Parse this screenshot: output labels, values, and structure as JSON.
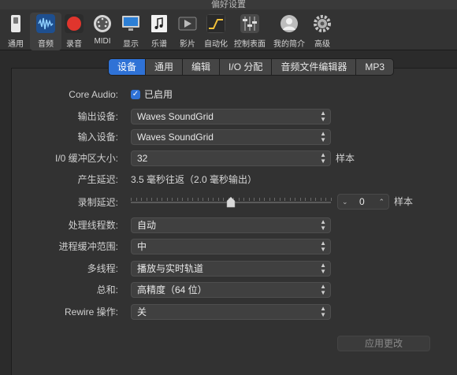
{
  "window": {
    "title": "偏好设置"
  },
  "toolbar": [
    {
      "label": "通用",
      "icon": "switch-icon"
    },
    {
      "label": "音频",
      "icon": "waveform-icon"
    },
    {
      "label": "录音",
      "icon": "record-icon"
    },
    {
      "label": "MIDI",
      "icon": "midi-port-icon"
    },
    {
      "label": "显示",
      "icon": "monitor-icon"
    },
    {
      "label": "乐谱",
      "icon": "score-icon"
    },
    {
      "label": "影片",
      "icon": "movie-icon"
    },
    {
      "label": "自动化",
      "icon": "automation-icon"
    },
    {
      "label": "控制表面",
      "icon": "faders-icon"
    },
    {
      "label": "我的简介",
      "icon": "profile-icon"
    },
    {
      "label": "高级",
      "icon": "gear-icon"
    }
  ],
  "tabs": [
    "设备",
    "通用",
    "编辑",
    "I/O 分配",
    "音频文件编辑器",
    "MP3"
  ],
  "selected_tab": "设备",
  "settings": {
    "core_audio": {
      "label": "Core Audio:",
      "checkbox": "已启用",
      "checked": true
    },
    "output_device": {
      "label": "输出设备:",
      "value": "Waves SoundGrid"
    },
    "input_device": {
      "label": "输入设备:",
      "value": "Waves SoundGrid"
    },
    "buffer_size": {
      "label": "I/0 缓冲区大小:",
      "value": "32",
      "unit": "样本"
    },
    "latency": {
      "label": "产生延迟:",
      "value": "3.5 毫秒往返（2.0 毫秒输出）"
    },
    "record_delay": {
      "label": "录制延迟:",
      "value": "0",
      "unit": "样本",
      "slider_position": 0.5
    },
    "process_threads": {
      "label": "处理线程数:",
      "value": "自动"
    },
    "process_buffer": {
      "label": "进程缓冲范围:",
      "value": "中"
    },
    "multithread": {
      "label": "多线程:",
      "value": "播放与实时轨道"
    },
    "summing": {
      "label": "总和:",
      "value": "高精度（64 位）"
    },
    "rewire": {
      "label": "Rewire 操作:",
      "value": "关"
    }
  },
  "apply_button": "应用更改",
  "colors": {
    "accent": "#2f72d6",
    "background": "#323232"
  }
}
